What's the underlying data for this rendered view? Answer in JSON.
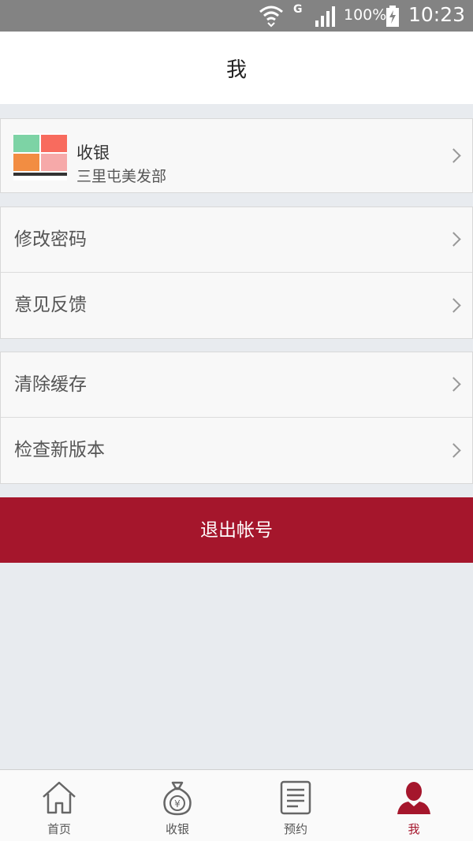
{
  "status_bar": {
    "network": "G",
    "battery_pct": "100%",
    "time": "10:23"
  },
  "header": {
    "title": "我"
  },
  "store": {
    "name": "收银",
    "subtitle": "三里屯美发部"
  },
  "settings": {
    "change_password": "修改密码",
    "feedback": "意见反馈",
    "clear_cache": "清除缓存",
    "check_update": "检查新版本"
  },
  "logout_label": "退出帐号",
  "tabs": [
    {
      "label": "首页",
      "icon": "home-icon"
    },
    {
      "label": "收银",
      "icon": "money-bag-icon"
    },
    {
      "label": "预约",
      "icon": "document-icon"
    },
    {
      "label": "我",
      "icon": "person-icon"
    }
  ],
  "colors": {
    "accent": "#a5162c",
    "status_bar": "#838383",
    "background": "#e8ebef"
  }
}
